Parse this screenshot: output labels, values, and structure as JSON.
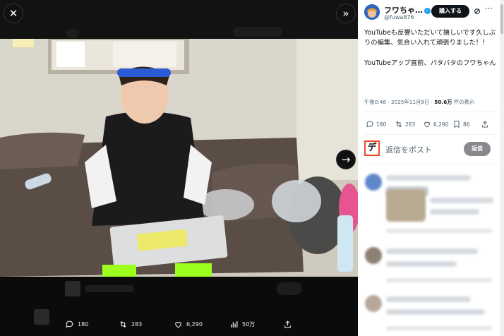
{
  "viewer": {
    "close_icon": "close-icon",
    "collapse_icon": "chevron-double-right-icon",
    "next_icon": "arrow-right-icon",
    "stats": {
      "replies": "180",
      "reposts": "283",
      "likes": "6,290",
      "views": "50万"
    }
  },
  "post": {
    "author_name": "フワちゃ…",
    "handle": "@fuwa876",
    "buy_label": "購入する",
    "text": "YouTubeも反響いただいて嬉しいです久しぶりの編集、気合い入れて頑張りました！！\n\nYouTubeアップ直前、バタバタのフワちゃん",
    "time": "午後0:48 · 2025年11月9日 · ",
    "views_count": "50.6万",
    "views_suffix": " 件の表示",
    "actions": {
      "replies": "180",
      "reposts": "283",
      "likes": "6,290",
      "bookmarks": "86"
    }
  },
  "reply": {
    "logo_glyph": "デ",
    "placeholder": "返信をポスト",
    "button": "返信"
  },
  "colors": {
    "verified": "#1d9bf0",
    "buy_bg": "#0f1419",
    "reply_logo_border": "#f04a24"
  }
}
